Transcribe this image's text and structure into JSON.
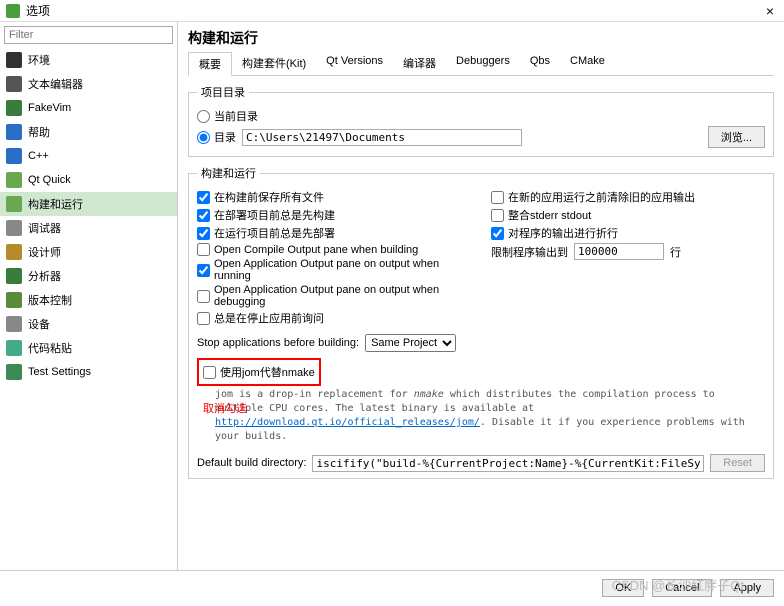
{
  "window": {
    "title": "选项",
    "close": "×"
  },
  "filter": {
    "placeholder": "Filter"
  },
  "sidebar": {
    "items": [
      {
        "label": "环境",
        "color": "#333"
      },
      {
        "label": "文本编辑器",
        "color": "#555"
      },
      {
        "label": "FakeVim",
        "color": "#3a7d3a"
      },
      {
        "label": "帮助",
        "color": "#2a6ec9"
      },
      {
        "label": "C++",
        "color": "#2a6ec9"
      },
      {
        "label": "Qt Quick",
        "color": "#6aa84f"
      },
      {
        "label": "构建和运行",
        "color": "#6aa84f"
      },
      {
        "label": "调试器",
        "color": "#888"
      },
      {
        "label": "设计师",
        "color": "#b88a2e"
      },
      {
        "label": "分析器",
        "color": "#3a7d3a"
      },
      {
        "label": "版本控制",
        "color": "#5a8a3a"
      },
      {
        "label": "设备",
        "color": "#888"
      },
      {
        "label": "代码粘贴",
        "color": "#4a8"
      },
      {
        "label": "Test Settings",
        "color": "#3a8a5a"
      }
    ],
    "selected": 6
  },
  "page": {
    "title": "构建和运行",
    "tabs": [
      "概要",
      "构建套件(Kit)",
      "Qt Versions",
      "编译器",
      "Debuggers",
      "Qbs",
      "CMake"
    ],
    "activeTab": 0
  },
  "projdir": {
    "legend": "项目目录",
    "current": "当前目录",
    "dir": "目录",
    "path": "C:\\Users\\21497\\Documents",
    "browse": "浏览..."
  },
  "build": {
    "legend": "构建和运行",
    "left": [
      {
        "label": "在构建前保存所有文件",
        "checked": true
      },
      {
        "label": "在部署项目前总是先构建",
        "checked": true
      },
      {
        "label": "在运行项目前总是先部署",
        "checked": true
      },
      {
        "label": "Open Compile Output pane when building",
        "checked": false
      },
      {
        "label": "Open Application Output pane on output when running",
        "checked": true
      },
      {
        "label": "Open Application Output pane on output when debugging",
        "checked": false
      },
      {
        "label": "总是在停止应用前询问",
        "checked": false
      }
    ],
    "right": [
      {
        "label": "在新的应用运行之前清除旧的应用输出",
        "checked": false
      },
      {
        "label": "整合stderr stdout",
        "checked": false
      },
      {
        "label": "对程序的输出进行折行",
        "checked": true
      }
    ],
    "limit": {
      "label": "限制程序输出到",
      "value": "100000",
      "unit": "行"
    },
    "stopapps": {
      "label": "Stop applications before building:",
      "value": "Same Project"
    },
    "jom": {
      "label": "使用jom代替nmake",
      "desc_pre": "jom is a drop-in replacement for ",
      "desc_em": "nmake",
      "desc_mid": " which distributes the compilation process to multiple CPU cores. The latest binary is available at ",
      "link": "http://download.qt.io/official_releases/jom/",
      "desc_post": ". Disable it if you experience problems with your builds."
    },
    "annotation": "取消勾选",
    "builddir": {
      "label": "Default build directory:",
      "value": "iscifify(\"build-%{CurrentProject:Name}-%{CurrentKit:FileSystemName}-%{CurrentBuild:Name}\")}",
      "reset": "Reset"
    }
  },
  "footer": {
    "ok": "OK",
    "cancel": "Cancel",
    "apply": "Apply"
  },
  "watermark": "CSDN @长沙红胖子Qt"
}
